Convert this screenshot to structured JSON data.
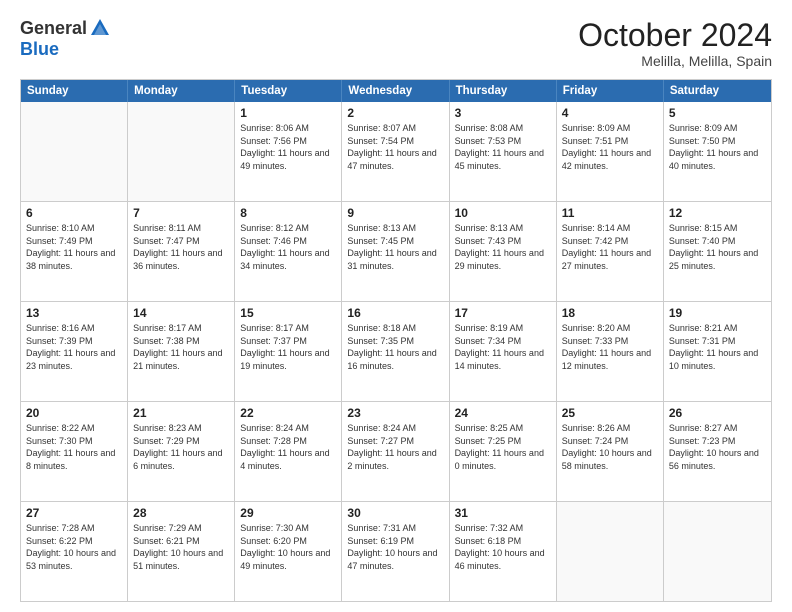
{
  "header": {
    "logo": {
      "general": "General",
      "blue": "Blue"
    },
    "title": "October 2024",
    "subtitle": "Melilla, Melilla, Spain"
  },
  "weekdays": [
    "Sunday",
    "Monday",
    "Tuesday",
    "Wednesday",
    "Thursday",
    "Friday",
    "Saturday"
  ],
  "weeks": [
    [
      {
        "day": "",
        "empty": true
      },
      {
        "day": "",
        "empty": true
      },
      {
        "day": "1",
        "sunrise": "Sunrise: 8:06 AM",
        "sunset": "Sunset: 7:56 PM",
        "daylight": "Daylight: 11 hours and 49 minutes."
      },
      {
        "day": "2",
        "sunrise": "Sunrise: 8:07 AM",
        "sunset": "Sunset: 7:54 PM",
        "daylight": "Daylight: 11 hours and 47 minutes."
      },
      {
        "day": "3",
        "sunrise": "Sunrise: 8:08 AM",
        "sunset": "Sunset: 7:53 PM",
        "daylight": "Daylight: 11 hours and 45 minutes."
      },
      {
        "day": "4",
        "sunrise": "Sunrise: 8:09 AM",
        "sunset": "Sunset: 7:51 PM",
        "daylight": "Daylight: 11 hours and 42 minutes."
      },
      {
        "day": "5",
        "sunrise": "Sunrise: 8:09 AM",
        "sunset": "Sunset: 7:50 PM",
        "daylight": "Daylight: 11 hours and 40 minutes."
      }
    ],
    [
      {
        "day": "6",
        "sunrise": "Sunrise: 8:10 AM",
        "sunset": "Sunset: 7:49 PM",
        "daylight": "Daylight: 11 hours and 38 minutes."
      },
      {
        "day": "7",
        "sunrise": "Sunrise: 8:11 AM",
        "sunset": "Sunset: 7:47 PM",
        "daylight": "Daylight: 11 hours and 36 minutes."
      },
      {
        "day": "8",
        "sunrise": "Sunrise: 8:12 AM",
        "sunset": "Sunset: 7:46 PM",
        "daylight": "Daylight: 11 hours and 34 minutes."
      },
      {
        "day": "9",
        "sunrise": "Sunrise: 8:13 AM",
        "sunset": "Sunset: 7:45 PM",
        "daylight": "Daylight: 11 hours and 31 minutes."
      },
      {
        "day": "10",
        "sunrise": "Sunrise: 8:13 AM",
        "sunset": "Sunset: 7:43 PM",
        "daylight": "Daylight: 11 hours and 29 minutes."
      },
      {
        "day": "11",
        "sunrise": "Sunrise: 8:14 AM",
        "sunset": "Sunset: 7:42 PM",
        "daylight": "Daylight: 11 hours and 27 minutes."
      },
      {
        "day": "12",
        "sunrise": "Sunrise: 8:15 AM",
        "sunset": "Sunset: 7:40 PM",
        "daylight": "Daylight: 11 hours and 25 minutes."
      }
    ],
    [
      {
        "day": "13",
        "sunrise": "Sunrise: 8:16 AM",
        "sunset": "Sunset: 7:39 PM",
        "daylight": "Daylight: 11 hours and 23 minutes."
      },
      {
        "day": "14",
        "sunrise": "Sunrise: 8:17 AM",
        "sunset": "Sunset: 7:38 PM",
        "daylight": "Daylight: 11 hours and 21 minutes."
      },
      {
        "day": "15",
        "sunrise": "Sunrise: 8:17 AM",
        "sunset": "Sunset: 7:37 PM",
        "daylight": "Daylight: 11 hours and 19 minutes."
      },
      {
        "day": "16",
        "sunrise": "Sunrise: 8:18 AM",
        "sunset": "Sunset: 7:35 PM",
        "daylight": "Daylight: 11 hours and 16 minutes."
      },
      {
        "day": "17",
        "sunrise": "Sunrise: 8:19 AM",
        "sunset": "Sunset: 7:34 PM",
        "daylight": "Daylight: 11 hours and 14 minutes."
      },
      {
        "day": "18",
        "sunrise": "Sunrise: 8:20 AM",
        "sunset": "Sunset: 7:33 PM",
        "daylight": "Daylight: 11 hours and 12 minutes."
      },
      {
        "day": "19",
        "sunrise": "Sunrise: 8:21 AM",
        "sunset": "Sunset: 7:31 PM",
        "daylight": "Daylight: 11 hours and 10 minutes."
      }
    ],
    [
      {
        "day": "20",
        "sunrise": "Sunrise: 8:22 AM",
        "sunset": "Sunset: 7:30 PM",
        "daylight": "Daylight: 11 hours and 8 minutes."
      },
      {
        "day": "21",
        "sunrise": "Sunrise: 8:23 AM",
        "sunset": "Sunset: 7:29 PM",
        "daylight": "Daylight: 11 hours and 6 minutes."
      },
      {
        "day": "22",
        "sunrise": "Sunrise: 8:24 AM",
        "sunset": "Sunset: 7:28 PM",
        "daylight": "Daylight: 11 hours and 4 minutes."
      },
      {
        "day": "23",
        "sunrise": "Sunrise: 8:24 AM",
        "sunset": "Sunset: 7:27 PM",
        "daylight": "Daylight: 11 hours and 2 minutes."
      },
      {
        "day": "24",
        "sunrise": "Sunrise: 8:25 AM",
        "sunset": "Sunset: 7:25 PM",
        "daylight": "Daylight: 11 hours and 0 minutes."
      },
      {
        "day": "25",
        "sunrise": "Sunrise: 8:26 AM",
        "sunset": "Sunset: 7:24 PM",
        "daylight": "Daylight: 10 hours and 58 minutes."
      },
      {
        "day": "26",
        "sunrise": "Sunrise: 8:27 AM",
        "sunset": "Sunset: 7:23 PM",
        "daylight": "Daylight: 10 hours and 56 minutes."
      }
    ],
    [
      {
        "day": "27",
        "sunrise": "Sunrise: 7:28 AM",
        "sunset": "Sunset: 6:22 PM",
        "daylight": "Daylight: 10 hours and 53 minutes."
      },
      {
        "day": "28",
        "sunrise": "Sunrise: 7:29 AM",
        "sunset": "Sunset: 6:21 PM",
        "daylight": "Daylight: 10 hours and 51 minutes."
      },
      {
        "day": "29",
        "sunrise": "Sunrise: 7:30 AM",
        "sunset": "Sunset: 6:20 PM",
        "daylight": "Daylight: 10 hours and 49 minutes."
      },
      {
        "day": "30",
        "sunrise": "Sunrise: 7:31 AM",
        "sunset": "Sunset: 6:19 PM",
        "daylight": "Daylight: 10 hours and 47 minutes."
      },
      {
        "day": "31",
        "sunrise": "Sunrise: 7:32 AM",
        "sunset": "Sunset: 6:18 PM",
        "daylight": "Daylight: 10 hours and 46 minutes."
      },
      {
        "day": "",
        "empty": true
      },
      {
        "day": "",
        "empty": true
      }
    ]
  ]
}
